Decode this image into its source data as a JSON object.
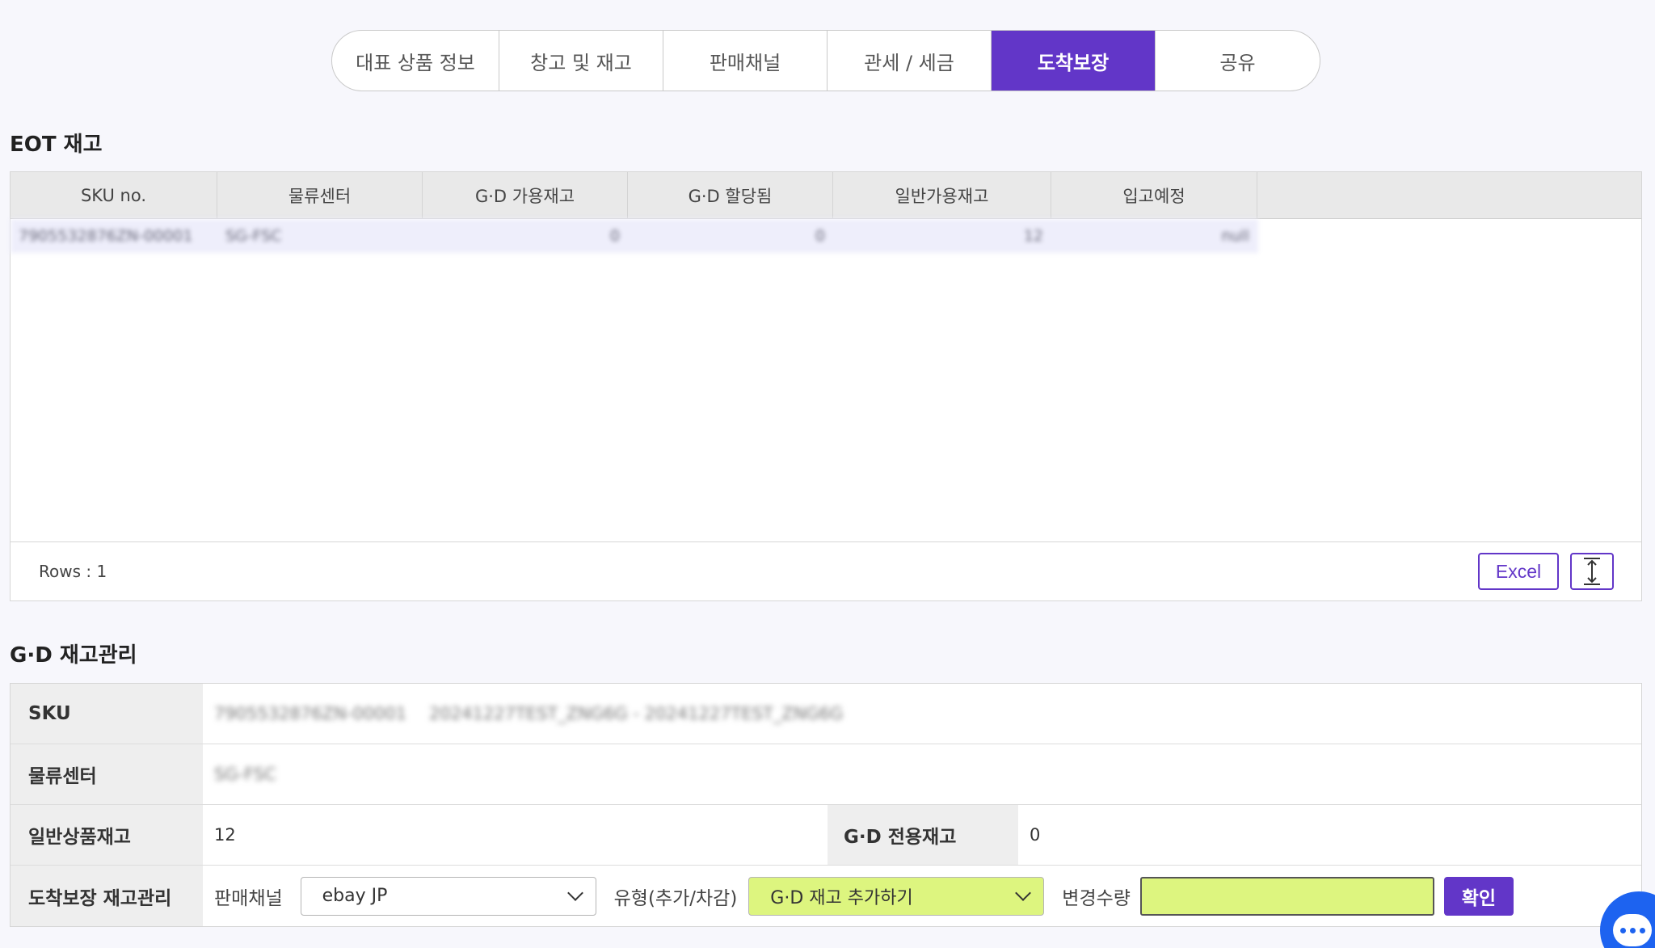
{
  "tabs": [
    {
      "label": "대표 상품 정보"
    },
    {
      "label": "창고 및 재고"
    },
    {
      "label": "판매채널"
    },
    {
      "label": "관세 / 세금"
    },
    {
      "label": "도착보장"
    },
    {
      "label": "공유"
    }
  ],
  "active_tab": "도착보장",
  "eot": {
    "title": "EOT 재고",
    "columns": [
      "SKU no.",
      "물류센터",
      "G·D 가용재고",
      "G·D 할당됨",
      "일반가용재고",
      "입고예정"
    ],
    "rows": [
      [
        "7905532876ZN-00001",
        "SG-FSC",
        "0",
        "0",
        "12",
        "null"
      ]
    ],
    "rows_count": "Rows : 1",
    "excel_label": "Excel"
  },
  "gd": {
    "title": "G·D 재고관리",
    "sku_label": "SKU",
    "sku_code": "7905532876ZN-00001",
    "sku_name": "20241227TEST_ZNG6G - 20241227TEST_ZNG6G",
    "fc_label": "물류센터",
    "fc_value": "SG-FSC",
    "general_stock_label": "일반상품재고",
    "general_stock_value": "12",
    "gd_stock_label": "G·D 전용재고",
    "gd_stock_value": "0",
    "manage_label": "도착보장 재고관리",
    "channel_label": "판매채널",
    "channel_value": "ebay JP",
    "type_label": "유형(추가/차감)",
    "type_value": "G·D 재고 추가하기",
    "qty_label": "변경수량",
    "qty_value": "",
    "confirm_label": "확인"
  },
  "colors": {
    "accent": "#6236c8",
    "highlight": "#ddf57f",
    "chat": "#1d63f0"
  }
}
